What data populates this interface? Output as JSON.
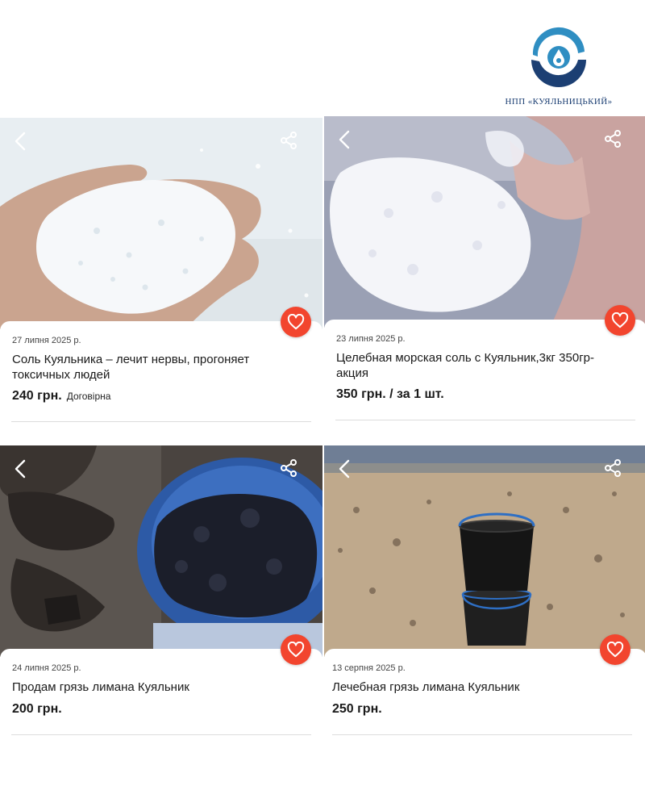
{
  "logo": {
    "text": "НПП «КУЯЛЬНИЦЬКИЙ»"
  },
  "listings": [
    {
      "date": "27 липня 2025 р.",
      "title": "Соль Куяльника – лечит нервы, прогоняет токсичных людей",
      "price": "240 грн.",
      "negotiable": "Договірна"
    },
    {
      "date": "23 липня 2025 р.",
      "title": "Целебная морская соль с Куяльник,3кг 350гр- акция",
      "price": "350 грн. / за 1 шт.",
      "negotiable": ""
    },
    {
      "date": "24 липня 2025 р.",
      "title": "Продам грязь лимана Куяльник",
      "price": "200 грн.",
      "negotiable": ""
    },
    {
      "date": "13 серпня 2025 р.",
      "title": "Лечебная грязь лимана Куяльник",
      "price": "250 грн.",
      "negotiable": ""
    }
  ],
  "icons": {
    "back": "chevron-left-icon",
    "share": "share-icon",
    "favorite": "heart-icon"
  },
  "colors": {
    "accent": "#f2452e",
    "brand": "#1c3f73",
    "brand_light": "#2f8ec2"
  }
}
